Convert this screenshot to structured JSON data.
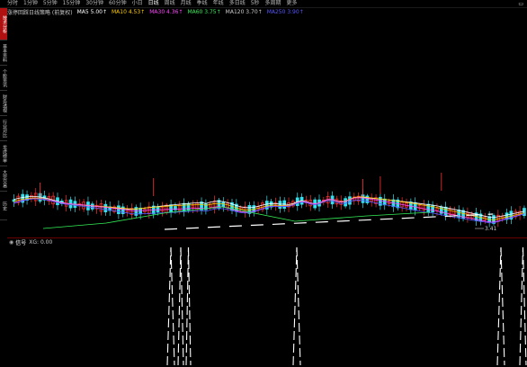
{
  "toolbar": {
    "items": [
      "分时",
      "1分钟",
      "5分钟",
      "15分钟",
      "30分钟",
      "60分钟",
      "小日",
      "日线",
      "周线",
      "月线",
      "季线",
      "年线",
      "多日线",
      "5秒",
      "多周期",
      "更多"
    ],
    "active_index": 7,
    "right_icon": "restore-window-icon"
  },
  "ma_legend": {
    "title": "涨停回踩日线策略 (前复权)",
    "items": [
      {
        "label": "MA5",
        "value": "5.00↑",
        "color": "#ffffff"
      },
      {
        "label": "MA10",
        "value": "4.53↑",
        "color": "#ffcc00"
      },
      {
        "label": "MA30",
        "value": "4.36↑",
        "color": "#ff44ff"
      },
      {
        "label": "MA60",
        "value": "3.75↑",
        "color": "#33ee55"
      },
      {
        "label": "MA120",
        "value": "3.70↑",
        "color": "#cccccc"
      },
      {
        "label": "MA250",
        "value": "3.90↑",
        "color": "#5555ff"
      }
    ]
  },
  "left_tabs": [
    {
      "label": "技术分析",
      "active": true
    },
    {
      "label": "基本资料",
      "active": false
    },
    {
      "label": "个股资讯",
      "active": false
    },
    {
      "label": "财务透视",
      "active": false
    },
    {
      "label": "行业对比",
      "active": false
    },
    {
      "label": "龙虎榜单",
      "active": false
    },
    {
      "label": "大宗交易",
      "active": false
    },
    {
      "label": "历史",
      "active": false
    }
  ],
  "price_annotation": "3.41",
  "sub_indicator": {
    "name": "信号",
    "params": "XG: 0.00"
  },
  "colors": {
    "up": "#ff3030",
    "down": "#33e0ee",
    "ma5": "#ffffff",
    "ma10": "#ffcc00",
    "ma30": "#ff44ff",
    "ma60": "#33ee55",
    "ma120": "#cccccc",
    "ma250": "#5555ff"
  }
}
